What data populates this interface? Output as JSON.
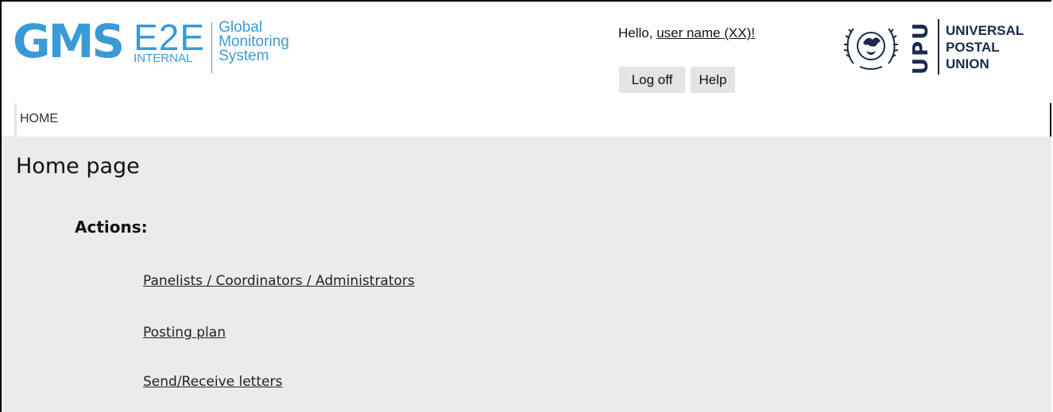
{
  "brand": {
    "gms": "GMS",
    "e2e": "E2E",
    "internal": "INTERNAL",
    "subtitle_lines": [
      "Global",
      "Monitoring",
      "System"
    ],
    "color": "#3a9ad7"
  },
  "user": {
    "greeting": "Hello, ",
    "name": "user name (XX)!"
  },
  "header_buttons": {
    "logoff": "Log off",
    "help": "Help"
  },
  "upu": {
    "letters": "UPU",
    "name_lines": [
      "UNIVERSAL",
      "POSTAL",
      "UNION"
    ],
    "color": "#1a2a4a"
  },
  "breadcrumb": {
    "home": "HOME"
  },
  "main": {
    "title": "Home page",
    "actions_label": "Actions:",
    "actions": [
      "Panelists / Coordinators / Administrators",
      "Posting plan",
      "Send/Receive letters"
    ]
  }
}
